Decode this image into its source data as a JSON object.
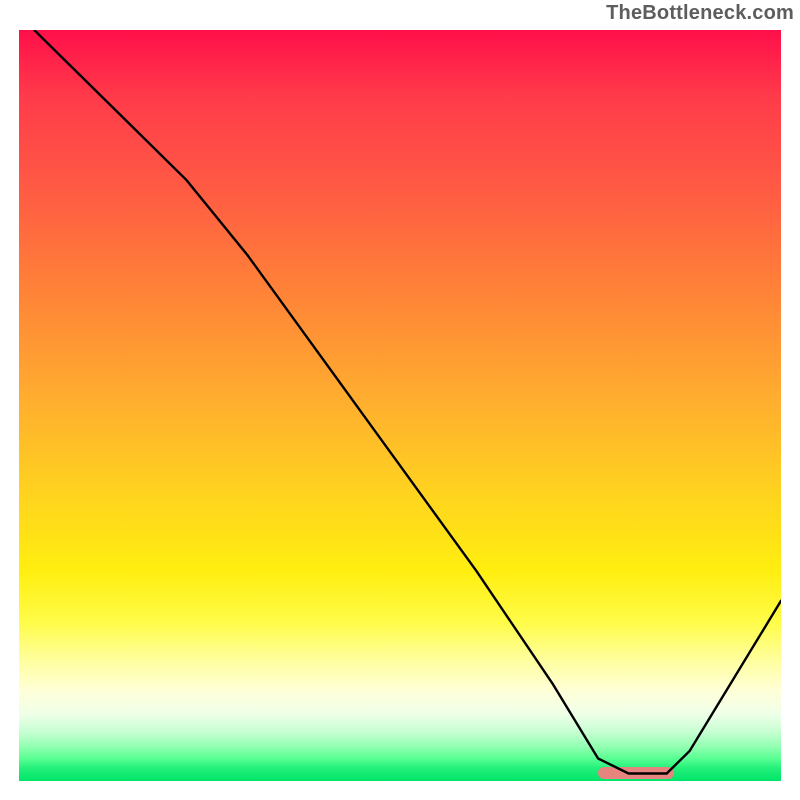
{
  "watermark": "TheBottleneck.com",
  "chart_data": {
    "type": "line",
    "title": "",
    "xlabel": "",
    "ylabel": "",
    "ylim": [
      0,
      100
    ],
    "xlim": [
      0,
      100
    ],
    "series": [
      {
        "name": "bottleneck-curve",
        "x": [
          2,
          10,
          22,
          30,
          40,
          50,
          60,
          70,
          76,
          80,
          85,
          88,
          100
        ],
        "values": [
          100,
          92,
          80,
          70,
          56,
          42,
          28,
          13,
          3,
          1,
          1,
          4,
          24
        ]
      }
    ],
    "highlight": {
      "x_start": 76,
      "x_end": 86,
      "y": 1
    },
    "colors": {
      "curve": "#000000",
      "highlight_bar": "#e6857f",
      "gradient_top": "#ff0f4a",
      "gradient_bottom": "#00e56a"
    }
  }
}
